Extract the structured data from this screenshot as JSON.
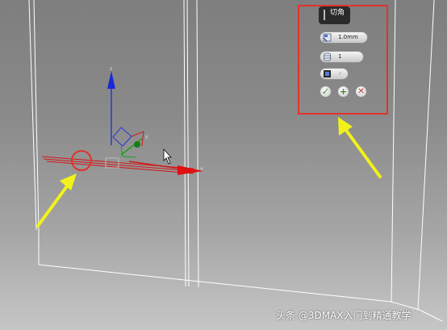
{
  "viewport": {
    "axis_labels": {
      "x": "x",
      "y": "y",
      "z": "z"
    }
  },
  "chamfer_caddy": {
    "title": "切角",
    "amount": "1.0mm",
    "segments": "1",
    "open_checkbox": "✓",
    "icons": {
      "amount": "chamfer-amount-icon",
      "segments": "segments-icon",
      "open": "open-chamfer-icon",
      "ok": "checkmark-icon",
      "apply": "plus-icon",
      "cancel": "cancel-x-icon"
    },
    "button_glyphs": {
      "ok": "✓",
      "apply": "+",
      "cancel": "✕"
    }
  },
  "watermark": {
    "text": "头条 @3DMAX入门到精通教学"
  },
  "colors": {
    "highlight": "#e0322c",
    "annotation_arrow": "#f2f21a",
    "x_axis": "#d01a1a",
    "y_axis": "#1aa01a",
    "z_axis": "#2a36d0",
    "wireframe": "#ffffff"
  }
}
